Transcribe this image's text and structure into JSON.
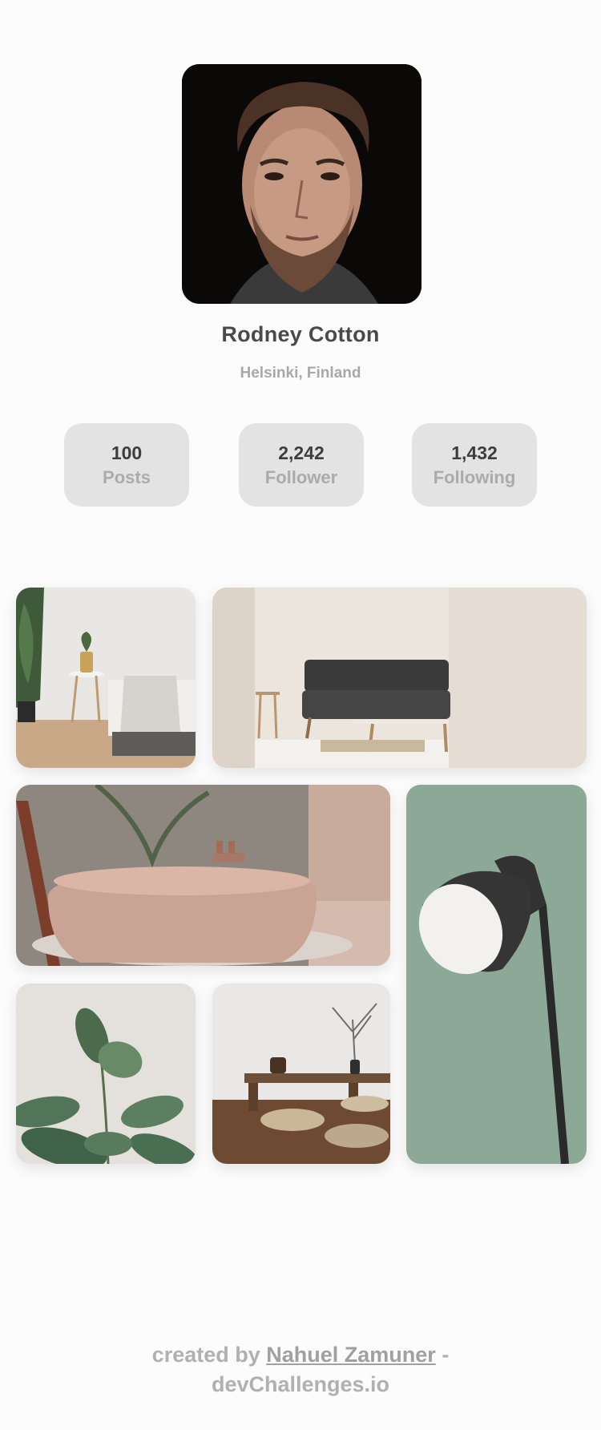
{
  "profile": {
    "name": "Rodney Cotton",
    "location": "Helsinki, Finland"
  },
  "stats": [
    {
      "value": "100",
      "label": "Posts"
    },
    {
      "value": "2,242",
      "label": "Follower"
    },
    {
      "value": "1,432",
      "label": "Following"
    }
  ],
  "gallery": [
    {
      "name": "bedroom-photo"
    },
    {
      "name": "living-room-photo"
    },
    {
      "name": "bathtub-photo"
    },
    {
      "name": "floor-lamp-photo"
    },
    {
      "name": "plant-leaves-photo"
    },
    {
      "name": "tea-table-photo"
    }
  ],
  "footer": {
    "prefix": "created by",
    "author": "Nahuel Zamuner",
    "dash": "-",
    "site": "devChallenges.io"
  },
  "colors": {
    "background": "#fcfcfc",
    "stat_card": "#e3e3e3",
    "name_text": "#4a4a4a",
    "muted_text": "#a8a8a8"
  }
}
